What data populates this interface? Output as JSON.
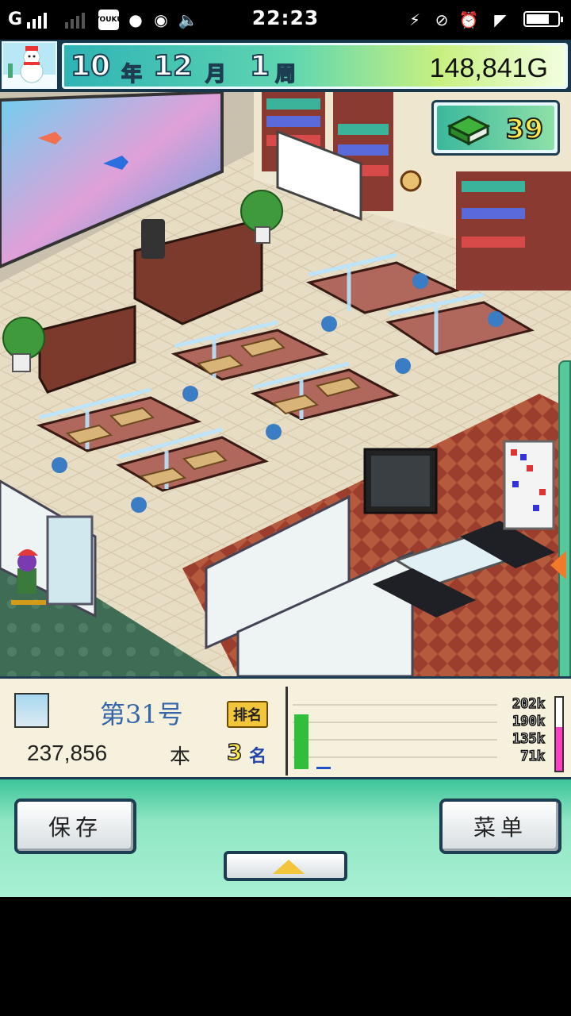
{
  "status_bar": {
    "carrier": "G",
    "time": "22:23",
    "icons": [
      "signal-icon",
      "youku-icon",
      "qq-icon",
      "chat-icon",
      "volume-icon",
      "charging-icon",
      "mute-icon",
      "alarm-icon",
      "wifi-icon",
      "battery-icon"
    ]
  },
  "hud": {
    "year": "10",
    "year_unit": "年",
    "month": "12",
    "month_unit": "月",
    "week": "1",
    "week_unit": "周",
    "money": "148,841G",
    "book_stock": "39"
  },
  "panel": {
    "issue": "第31号",
    "rank_label": "排名",
    "sales": "237,856",
    "sales_unit": "本",
    "rank": "3",
    "rank_unit": "名"
  },
  "chart_data": {
    "type": "bar",
    "ticks": [
      "202k",
      "190k",
      "135k",
      "71k"
    ],
    "ylim": [
      0,
      270
    ],
    "series": [
      {
        "values": [
          202,
          10
        ]
      }
    ],
    "gauge_fraction": 0.6
  },
  "controls": {
    "save_label": "保存",
    "menu_label": "菜单"
  },
  "colors": {
    "accent": "#3dc49a",
    "hud_dark": "#1d3e52",
    "gauge": "#ff3cc8"
  }
}
